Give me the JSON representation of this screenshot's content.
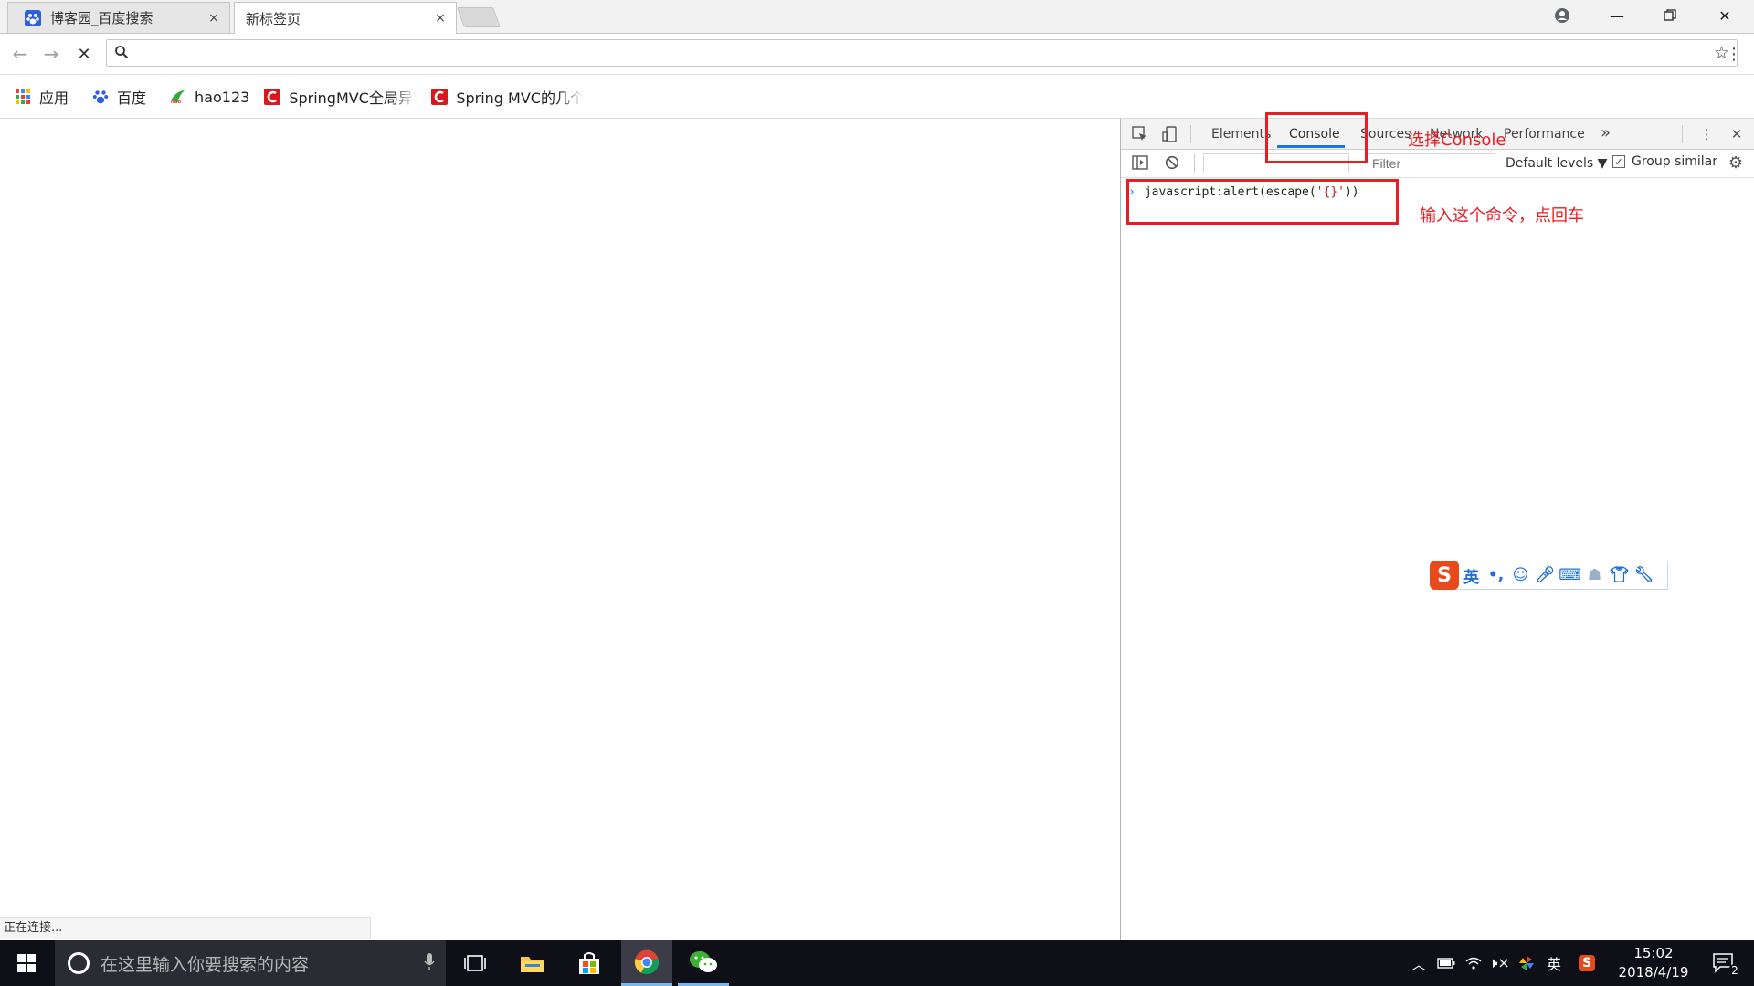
{
  "browser": {
    "tabs": [
      {
        "title": "博客园_百度搜索",
        "close": "×",
        "active": false
      },
      {
        "title": "新标签页",
        "close": "×",
        "active": true
      }
    ],
    "address": {
      "value": "",
      "placeholder": ""
    },
    "bookmarks": [
      {
        "label": "应用",
        "icon": "apps-grid-icon"
      },
      {
        "label": "百度",
        "icon": "baidu-paw-icon"
      },
      {
        "label": "hao123",
        "icon": "hao123-icon"
      },
      {
        "label": "SpringMVC全局异常",
        "icon": "csdn-c-icon"
      },
      {
        "label": "Spring MVC的几个注",
        "icon": "csdn-c-icon"
      }
    ],
    "status_text": "正在连接..."
  },
  "devtools": {
    "tabs": [
      "Elements",
      "Console",
      "Sources",
      "Network",
      "Performance"
    ],
    "more": "»",
    "filter_placeholder": "Filter",
    "levels_label": "Default levels ▼",
    "group_similar_label": "Group similar",
    "console_input": {
      "prefix": "javascript:alert(escape(",
      "string": "'{}'",
      "suffix": "))"
    }
  },
  "annotations": {
    "select_console": "选择Console",
    "enter_command": "输入这个命令，点回车"
  },
  "ime": {
    "mode_label": "英"
  },
  "taskbar": {
    "search_placeholder": "在这里输入你要搜索的内容",
    "lang_label": "英",
    "time": "15:02",
    "date": "2018/4/19",
    "notification_count": "2"
  },
  "colors": {
    "annotation_red": "#ea1d24",
    "accent_blue": "#1a73e8"
  }
}
